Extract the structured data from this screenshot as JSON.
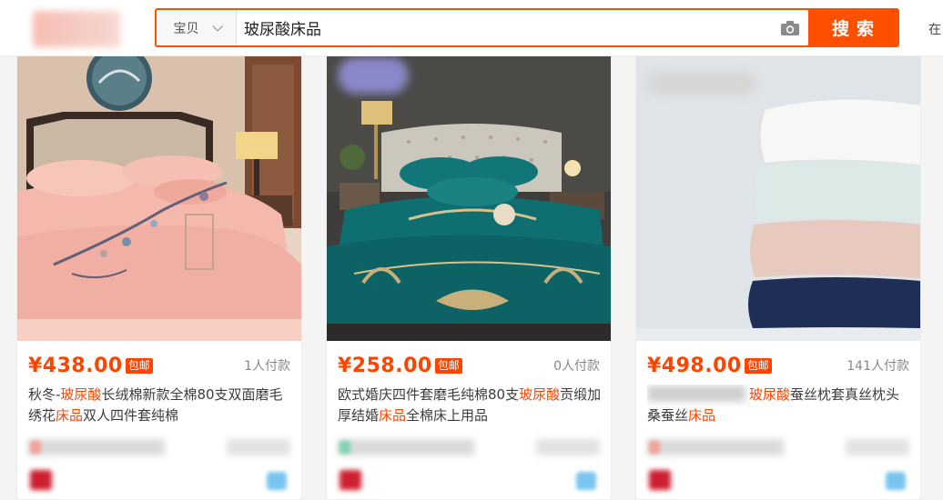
{
  "search": {
    "scope_label": "宝贝",
    "query": "玻尿酸床品",
    "button_label": "搜索",
    "right_stub": "在"
  },
  "colors": {
    "accent": "#ff5000",
    "price": "#ff4400",
    "highlight": "#ff4400"
  },
  "products": [
    {
      "price": "¥438.00",
      "badge": "包邮",
      "sold": "1人付款",
      "title_parts": [
        "秋冬-",
        "玻尿酸",
        "长绒棉新款全棉80支双面磨毛绣花",
        "床品",
        "双人四件套纯棉"
      ]
    },
    {
      "price": "¥258.00",
      "badge": "包邮",
      "sold": "0人付款",
      "title_parts": [
        "欧式婚庆四件套磨毛纯棉80支",
        "玻尿酸",
        "贡缎加厚结婚",
        "床品",
        "全棉床上用品"
      ]
    },
    {
      "price": "¥498.00",
      "badge": "包邮",
      "sold": "141人付款",
      "title_parts": [
        "玻尿酸",
        "蚕丝枕套真丝枕头桑蚕丝",
        "床品"
      ]
    }
  ]
}
